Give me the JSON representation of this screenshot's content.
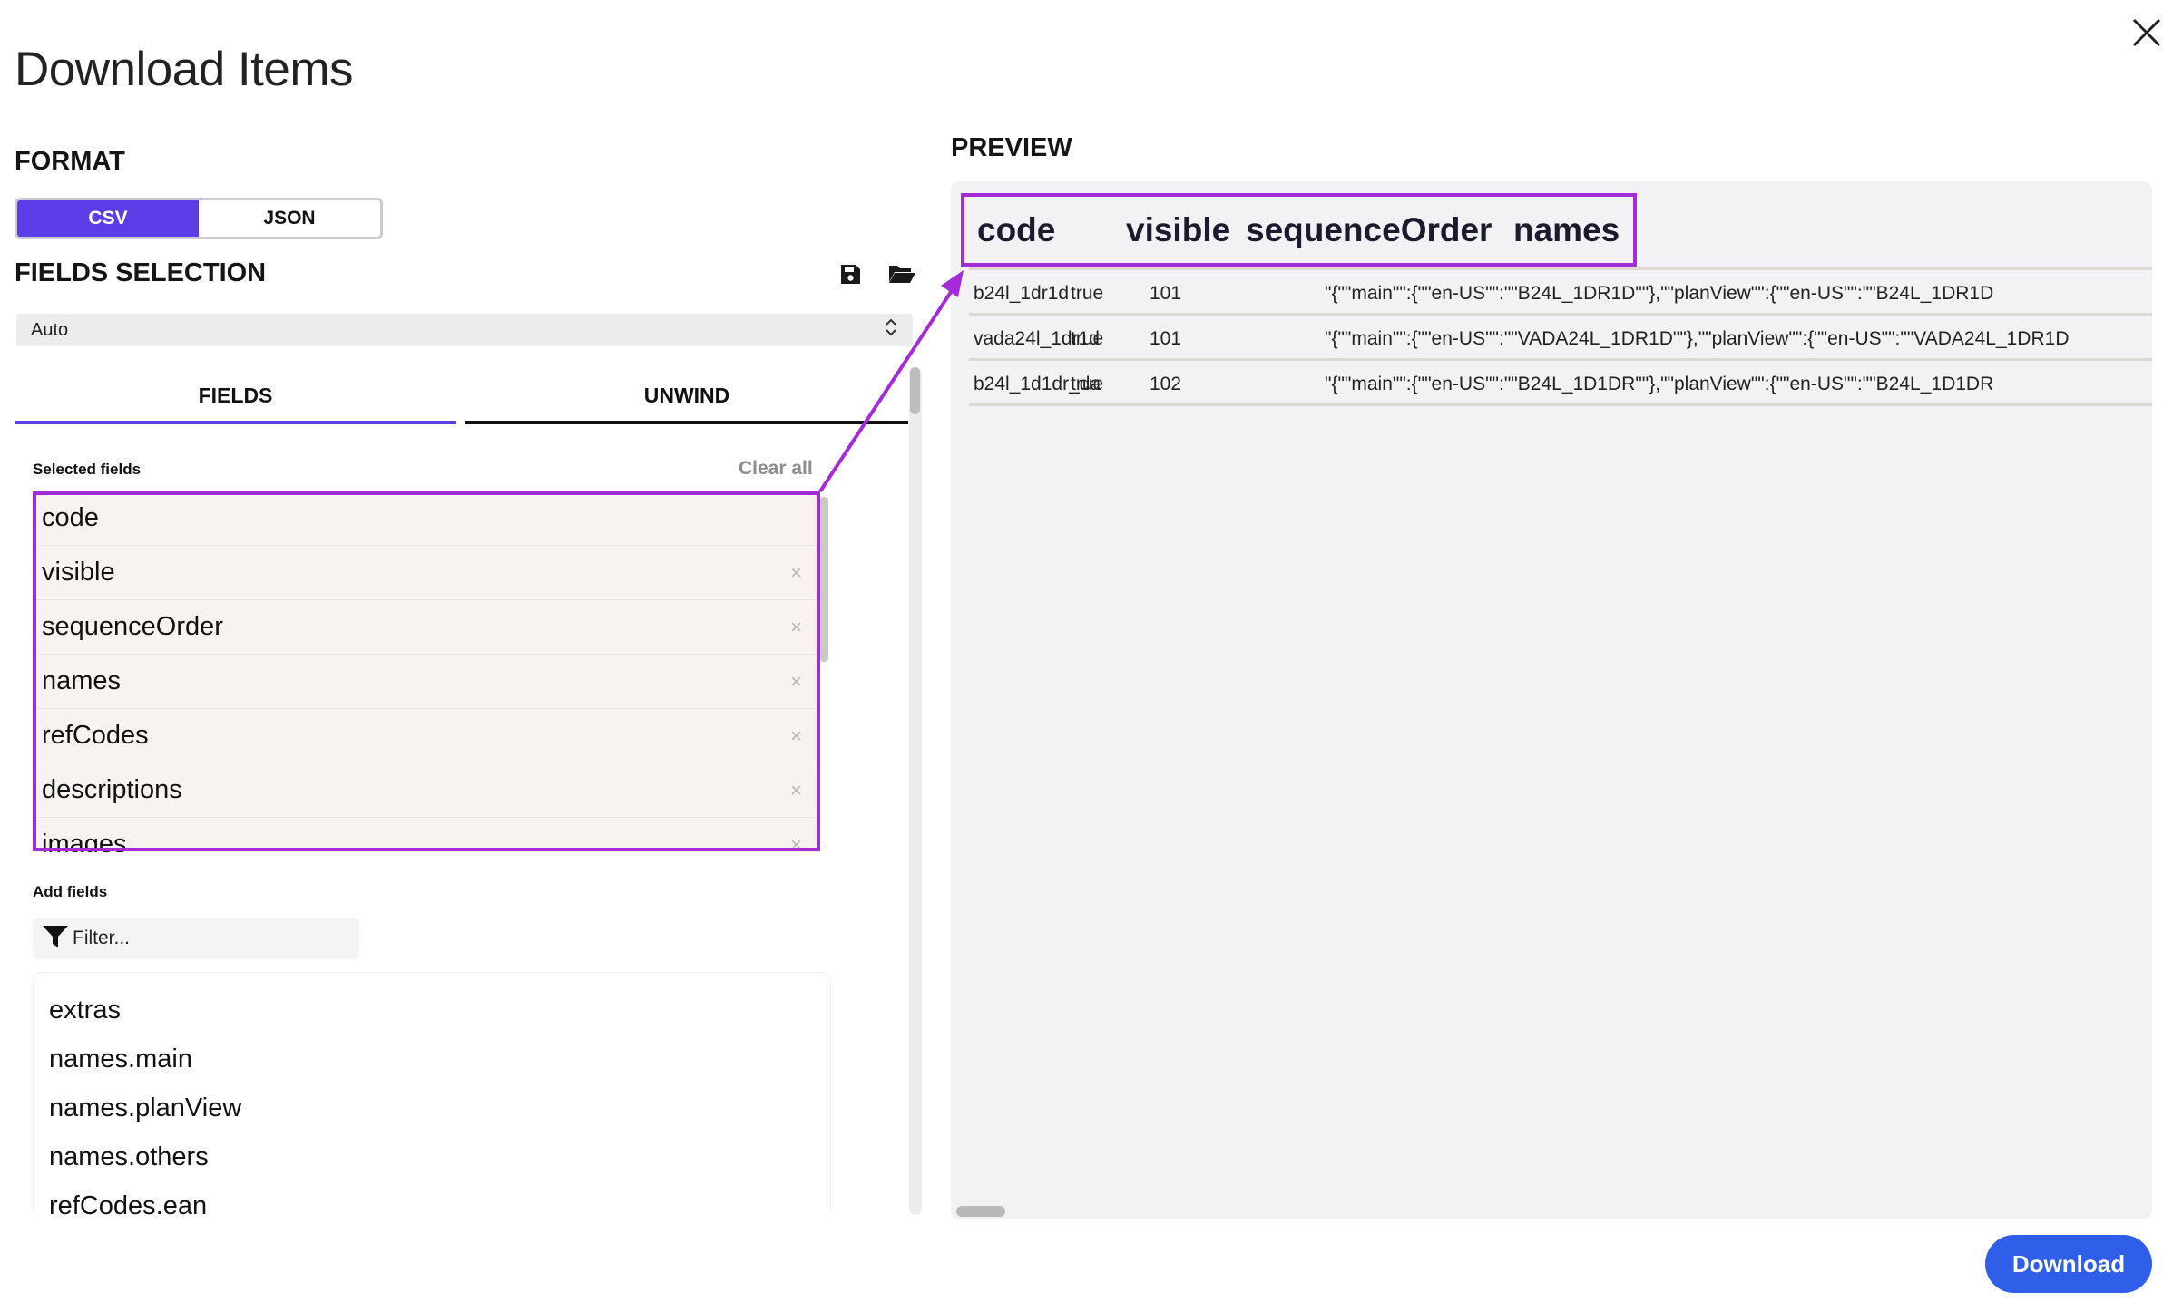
{
  "dialog": {
    "title": "Download Items",
    "close_icon": "close-icon"
  },
  "format": {
    "title": "FORMAT",
    "options": [
      "CSV",
      "JSON"
    ],
    "selected": "CSV",
    "accent": "#5b3ce6"
  },
  "fields_selection": {
    "title": "FIELDS SELECTION",
    "save_icon": "save-icon",
    "open_icon": "folder-open-icon",
    "mode_value": "Auto",
    "tabs": [
      "FIELDS",
      "UNWIND"
    ],
    "active_tab": "FIELDS",
    "selected_label": "Selected fields",
    "clear_all": "Clear all",
    "selected_fields": [
      "code",
      "visible",
      "sequenceOrder",
      "names",
      "refCodes",
      "descriptions",
      "images"
    ],
    "add_label": "Add fields",
    "filter_placeholder": "Filter...",
    "available_fields": [
      "extras",
      "names.main",
      "names.planView",
      "names.others",
      "refCodes.ean"
    ]
  },
  "preview": {
    "title": "PREVIEW",
    "headers": [
      "code",
      "visible",
      "sequenceOrder",
      "names"
    ],
    "rows": [
      [
        "b24l_1dr1d",
        "true",
        "101",
        "\"{\"\"main\"\":{\"\"en-US\"\":\"\"B24L_1DR1D\"\"},\"\"planView\"\":{\"\"en-US\"\":\"\"B24L_1DR1D"
      ],
      [
        "vada24l_1dr1d",
        "true",
        "101",
        "\"{\"\"main\"\":{\"\"en-US\"\":\"\"VADA24L_1DR1D\"\"},\"\"planView\"\":{\"\"en-US\"\":\"\"VADA24L_1DR1D"
      ],
      [
        "b24l_1d1dr_da",
        "true",
        "102",
        "\"{\"\"main\"\":{\"\"en-US\"\":\"\"B24L_1D1DR\"\"},\"\"planView\"\":{\"\"en-US\"\":\"\"B24L_1D1DR"
      ]
    ]
  },
  "highlight_color": "#a42bd8",
  "download": {
    "label": "Download",
    "color": "#2f5fe8"
  }
}
